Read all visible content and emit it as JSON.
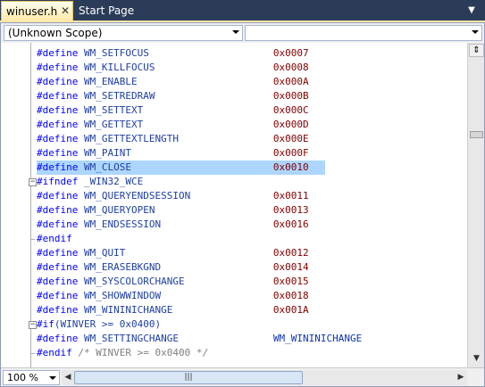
{
  "tabs": {
    "active_label": "winuser.h",
    "close_glyph": "✕",
    "inactive_label": "Start Page",
    "overflow_glyph": "▼"
  },
  "navbar": {
    "scope_value": "(Unknown Scope)",
    "member_value": ""
  },
  "editor": {
    "selected_line": 8,
    "lines": [
      {
        "a": "#define",
        "b": " WM_SETFOCUS",
        "pad": "                     ",
        "c": "0x0007",
        "kind": "val"
      },
      {
        "a": "#define",
        "b": " WM_KILLFOCUS",
        "pad": "                    ",
        "c": "0x0008",
        "kind": "val"
      },
      {
        "a": "#define",
        "b": " WM_ENABLE",
        "pad": "                       ",
        "c": "0x000A",
        "kind": "val"
      },
      {
        "a": "#define",
        "b": " WM_SETREDRAW",
        "pad": "                    ",
        "c": "0x000B",
        "kind": "val"
      },
      {
        "a": "#define",
        "b": " WM_SETTEXT",
        "pad": "                      ",
        "c": "0x000C",
        "kind": "val"
      },
      {
        "a": "#define",
        "b": " WM_GETTEXT",
        "pad": "                      ",
        "c": "0x000D",
        "kind": "val"
      },
      {
        "a": "#define",
        "b": " WM_GETTEXTLENGTH",
        "pad": "                ",
        "c": "0x000E",
        "kind": "val"
      },
      {
        "a": "#define",
        "b": " WM_PAINT",
        "pad": "                        ",
        "c": "0x000F",
        "kind": "val"
      },
      {
        "a": "#define",
        "b": " WM_CLOSE",
        "pad": "                        ",
        "c": "0x0010",
        "kind": "val"
      },
      {
        "a": "#ifndef",
        "b": " _WIN32_WCE",
        "pad": "",
        "c": "",
        "kind": "fold"
      },
      {
        "a": "#define",
        "b": " WM_QUERYENDSESSION",
        "pad": "              ",
        "c": "0x0011",
        "kind": "val"
      },
      {
        "a": "#define",
        "b": " WM_QUERYOPEN",
        "pad": "                    ",
        "c": "0x0013",
        "kind": "val"
      },
      {
        "a": "#define",
        "b": " WM_ENDSESSION",
        "pad": "                   ",
        "c": "0x0016",
        "kind": "val"
      },
      {
        "a": "#endif",
        "b": "",
        "pad": "",
        "c": "",
        "kind": "end"
      },
      {
        "a": "#define",
        "b": " WM_QUIT",
        "pad": "                         ",
        "c": "0x0012",
        "kind": "val"
      },
      {
        "a": "#define",
        "b": " WM_ERASEBKGND",
        "pad": "                   ",
        "c": "0x0014",
        "kind": "val"
      },
      {
        "a": "#define",
        "b": " WM_SYSCOLORCHANGE",
        "pad": "               ",
        "c": "0x0015",
        "kind": "val"
      },
      {
        "a": "#define",
        "b": " WM_SHOWWINDOW",
        "pad": "                   ",
        "c": "0x0018",
        "kind": "val"
      },
      {
        "a": "#define",
        "b": " WM_WININICHANGE",
        "pad": "                 ",
        "c": "0x001A",
        "kind": "val"
      },
      {
        "a": "#if",
        "b": "(WINVER >= 0x0400)",
        "pad": "",
        "c": "",
        "kind": "fold"
      },
      {
        "a": "#define",
        "b": " WM_SETTINGCHANGE",
        "pad": "                ",
        "c": "WM_WININICHANGE",
        "kind": "ident"
      },
      {
        "a": "#endif",
        "b": " ",
        "pad": "",
        "c": "/* WINVER >= 0x0400 */",
        "kind": "cmt"
      }
    ]
  },
  "scrollbar": {
    "split_glyph": "⇕",
    "down_glyph": "▼",
    "left_glyph": "◀",
    "right_glyph": "▶",
    "thumb_grip": "|||"
  },
  "zoom": {
    "value": "100 %"
  },
  "colors": {
    "keyword": "#0000ff",
    "value": "#800000",
    "selection": "#add6ff",
    "tab_active": "#ffe8a6",
    "chrome": "#2b3c59"
  }
}
